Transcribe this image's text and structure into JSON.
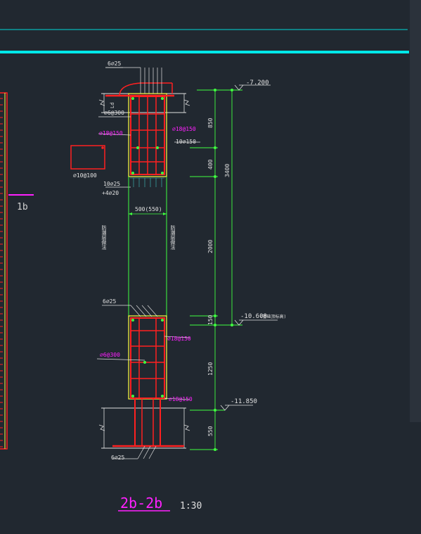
{
  "drawing": {
    "title": "2b-2b",
    "scale": "1:30",
    "section_mark": "1b"
  },
  "rebar_labels": {
    "top_bars": "6⌀25",
    "stirrup_top": "⌀6@300",
    "tie_left_top": "⌀18@150",
    "tie_right_top": "⌀18@150",
    "mid_bars": "10⌀150",
    "bottom_bars_upper": "10⌀25",
    "extra_bars": "+4⌀20",
    "beam_box": "⌀10@100",
    "wall_width": "500(550)",
    "lower_top_bars": "6⌀25",
    "lower_tie_right": "⌀18@150",
    "lower_stirrup": "⌀6@300",
    "lower_tie_bottom": "⌀18@150",
    "bottom_bars": "6⌀25",
    "vertical_note_left": "防潮层做法",
    "vertical_note_right": "防潮层做法",
    "top_rebar_tag": "Ld"
  },
  "elevations": {
    "top": "-7.200",
    "mid": "-10.600",
    "mid_note": "(基础顶标高)",
    "bottom": "-11.850"
  },
  "dimensions": {
    "d850": "850",
    "d400": "400",
    "d3400": "3400",
    "d2000": "2000",
    "d150": "150",
    "d1250": "1250",
    "d550": "550"
  },
  "colors": {
    "background": "#212830",
    "red": "#ff2020",
    "yellow": "#ffff40",
    "green": "#40ff40",
    "white": "#e0e0e0",
    "magenta": "#ff20ff",
    "cyan": "#00e0e0"
  }
}
